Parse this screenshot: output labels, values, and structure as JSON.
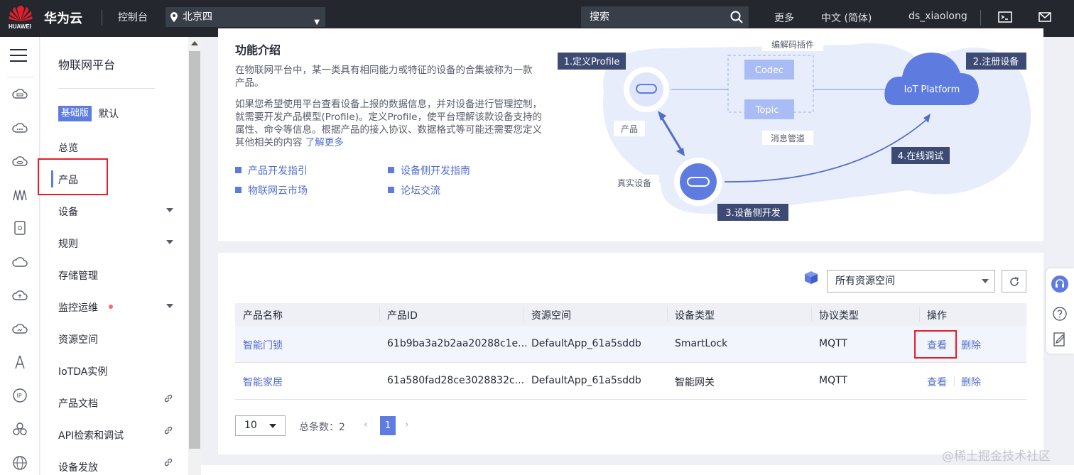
{
  "topbar": {
    "logo_text": "HUAWEI",
    "brand": "华为云",
    "console": "控制台",
    "region": "北京四",
    "search_placeholder": "搜索",
    "more": "更多",
    "language": "中文 (简体)",
    "username": "ds_xiaolong"
  },
  "sidenav": {
    "title": "物联网平台",
    "edition_badge": "基础版",
    "edition_name": "默认",
    "items": [
      {
        "label": "总览"
      },
      {
        "label": "产品"
      },
      {
        "label": "设备"
      },
      {
        "label": "规则"
      },
      {
        "label": "存储管理"
      },
      {
        "label": "监控运维"
      },
      {
        "label": "资源空间"
      },
      {
        "label": "IoTDA实例"
      },
      {
        "label": "产品文档"
      },
      {
        "label": "API检索和调试"
      },
      {
        "label": "设备发放"
      }
    ]
  },
  "intro": {
    "title": "功能介绍",
    "p1": "在物联网平台中，某一类具有相同能力或特征的设备的合集被称为一款产品。",
    "p2": "如果您希望使用平台查看设备上报的数据信息，并对设备进行管理控制，就需要开发产品模型(Profile)。定义Profile，使平台理解该款设备支持的属性、命令等信息。根据产品的接入协议、数据格式等可能还需要您定义其他相关的内容",
    "learn_more": "了解更多",
    "links": [
      "产品开发指引",
      "设备侧开发指南",
      "物联网云市场",
      "论坛交流"
    ]
  },
  "diagram": {
    "step1": "1.定义Profile",
    "step2": "2.注册设备",
    "step3": "3.设备侧开发",
    "step4": "4.在线调试",
    "codec_plugin": "编解码插件",
    "codec": "Codec",
    "topic": "Topic",
    "msg_pipe": "消息管道",
    "product": "产品",
    "real_device": "真实设备",
    "platform": "IoT Platform"
  },
  "filter": {
    "resource_space": "所有资源空间"
  },
  "table": {
    "headers": [
      "产品名称",
      "产品ID",
      "资源空间",
      "设备类型",
      "协议类型",
      "操作"
    ],
    "rows": [
      {
        "name": "智能门锁",
        "id": "61b9ba3a2b2aa20288c1e...",
        "space": "DefaultApp_61a5sddb",
        "type": "SmartLock",
        "protocol": "MQTT",
        "view": "查看",
        "delete": "删除"
      },
      {
        "name": "智能家居",
        "id": "61a580fad28ce3028832c...",
        "space": "DefaultApp_61a5sddb",
        "type": "智能网关",
        "protocol": "MQTT",
        "view": "查看",
        "delete": "删除"
      }
    ]
  },
  "pagination": {
    "page_size": "10",
    "total": "总条数：2",
    "current": "1"
  },
  "watermark": "@稀土掘金技术社区",
  "colors": {
    "accent": "#5e7ce0",
    "link": "#526ecc",
    "highlight": "#e41f2b",
    "topbar": "#24282e"
  }
}
